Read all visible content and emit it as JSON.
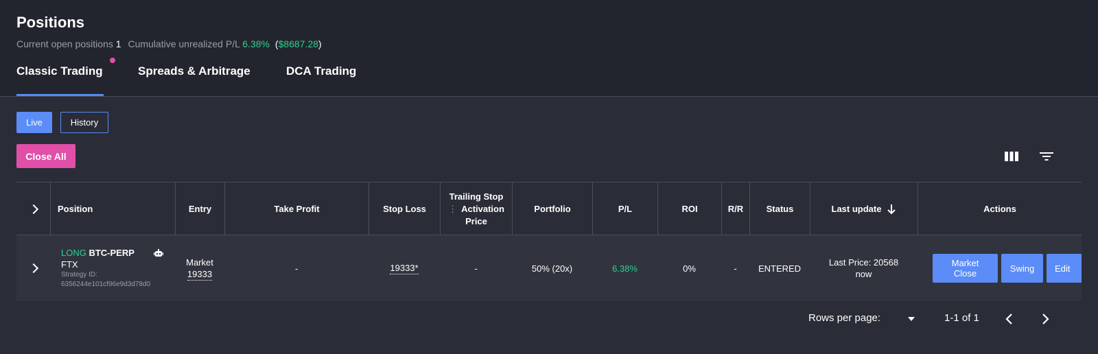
{
  "header": {
    "title": "Positions",
    "open_positions_label": "Current open positions",
    "open_positions_count": "1",
    "cumulative_label": "Cumulative unrealized P/L",
    "cumulative_pct": "6.38%",
    "cumulative_open_paren": "(",
    "cumulative_usd": "$8687.28",
    "cumulative_close_paren": ")"
  },
  "tabs": [
    {
      "label": "Classic Trading",
      "active": true,
      "has_dot": true
    },
    {
      "label": "Spreads & Arbitrage",
      "active": false
    },
    {
      "label": "DCA Trading",
      "active": false
    }
  ],
  "toolbar": {
    "live_label": "Live",
    "history_label": "History",
    "close_all_label": "Close All",
    "columns_icon": "view-columns-icon",
    "filter_icon": "filter-icon"
  },
  "table": {
    "headers": {
      "position": "Position",
      "entry": "Entry",
      "take_profit": "Take Profit",
      "stop_loss": "Stop Loss",
      "trailing_line1": "Trailing Stop",
      "trailing_line2": "Activation",
      "trailing_line3": "Price",
      "portfolio": "Portfolio",
      "pl": "P/L",
      "roi": "ROI",
      "rr": "R/R",
      "status": "Status",
      "last_update": "Last update",
      "actions": "Actions"
    },
    "rows": [
      {
        "side": "LONG",
        "symbol": "BTC-PERP",
        "exchange": "FTX",
        "strategy_label": "Strategy ID:",
        "strategy_id": "6356244e101cf96e9d3d78d0",
        "entry_type": "Market",
        "entry_price": "19333",
        "take_profit": "-",
        "stop_loss": "19333*",
        "trailing": "-",
        "portfolio": "50% (20x)",
        "pl": "6.38%",
        "roi": "0%",
        "rr": "-",
        "status": "ENTERED",
        "last_price": "Last Price: 20568",
        "last_time": "now",
        "actions": {
          "market_close_line1": "Market",
          "market_close_line2": "Close",
          "swing": "Swing",
          "edit": "Edit"
        }
      }
    ]
  },
  "pagination": {
    "rows_per_page_label": "Rows per page:",
    "range": "1-1 of 1"
  },
  "colors": {
    "accent": "#5b8cf7",
    "positive": "#2fd18c",
    "danger": "#e04fa8",
    "background": "#2a2d37"
  }
}
